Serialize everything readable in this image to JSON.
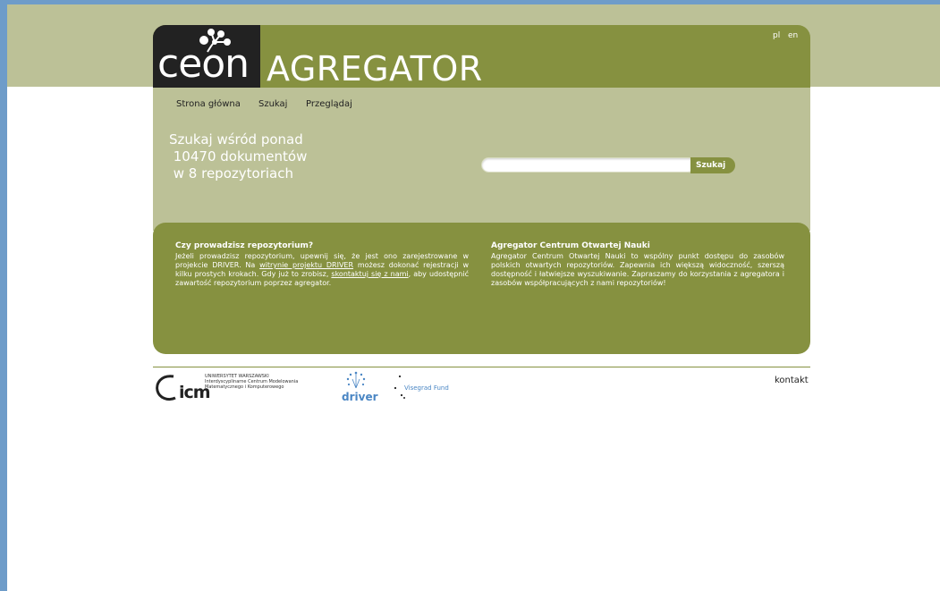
{
  "header": {
    "logo_ceon": "ceon",
    "logo_title": "AGREGATOR",
    "lang_pl": "pl",
    "lang_en": "en"
  },
  "nav": {
    "home": "Strona główna",
    "search": "Szukaj",
    "browse": "Przeglądaj"
  },
  "hero": {
    "headline": "Szukaj wśród ponad\n 10470 dokumentów\n w 8 repozytoriach"
  },
  "search": {
    "value": "",
    "button_label": "Szukaj"
  },
  "info_left": {
    "title": "Czy prowadzisz repozytorium?",
    "text_1": "Jeżeli prowadzisz repozytorium, upewnij się, że jest ono zarejestrowane w projekcie DRIVER. Na ",
    "link_1": "witrynie projektu DRIVER",
    "text_2": " możesz dokonać rejestracji w kilku prostych krokach. Gdy już to zrobisz, ",
    "link_2": "skontaktuj się z nami",
    "text_3": ", aby udostępnić zawartość repozytorium poprzez agregator."
  },
  "info_right": {
    "title": "Agregator Centrum Otwartej Nauki",
    "text": "Agregator Centrum Otwartej Nauki to wspólny punkt dostępu do zasobów polskich otwartych repozytoriów. Zapewnia ich większą widoczność, szerszą dostępność i łatwiejsze wyszukiwanie. Zapraszamy do korzystania z agregatora i zasobów współpracujących z nami repozytoriów!"
  },
  "footer": {
    "icm_short": "icm",
    "icm_sub": "UNIWERSYTET WARSZAWSKI\nInterdyscyplinarne Centrum Modelowania\nMatematycznego i Komputerowego",
    "driver": "driver",
    "visegrad": "Visegrad Fund",
    "kontakt": "kontakt"
  },
  "colors": {
    "olive": "#869140",
    "light_olive": "#bcc197",
    "frame_blue": "#6e9cc9"
  }
}
